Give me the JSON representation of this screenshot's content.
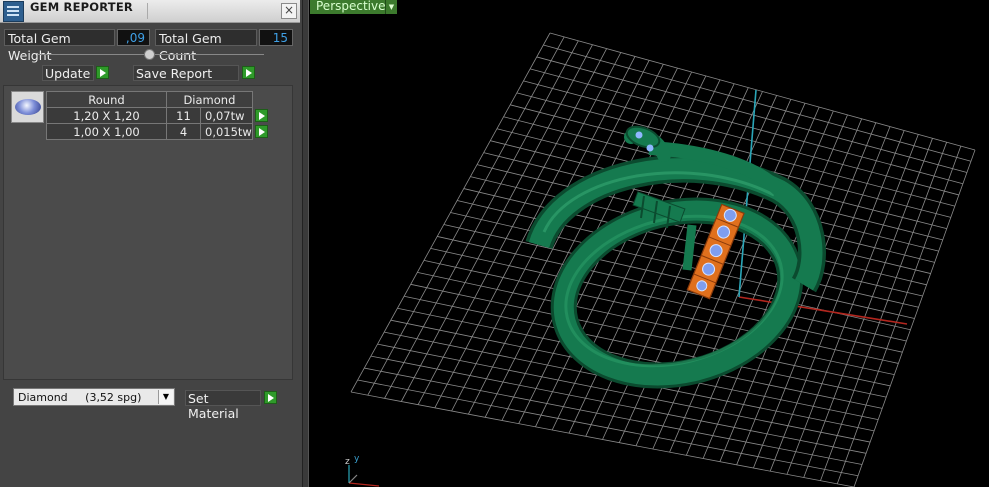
{
  "panel": {
    "title": "GEM REPORTER",
    "close_glyph": "×",
    "icons": {
      "app": "gem-reporter-icon",
      "close": "close-icon",
      "run": "play-arrow-icon",
      "dropdown": "chevron-down-icon"
    }
  },
  "totals": {
    "weight_label": "Total Gem Weight",
    "weight_value": ",09",
    "count_label": "Total Gem Count",
    "count_value": "15"
  },
  "actions": {
    "update_label": "Update",
    "save_label": "Save Report"
  },
  "report": {
    "headers": [
      "Round",
      "Diamond"
    ],
    "rows": [
      {
        "size": "1,20 X 1,20",
        "count": "11",
        "weight": "0,07tw"
      },
      {
        "size": "1,00 X 1,00",
        "count": "4",
        "weight": "0,015tw"
      }
    ]
  },
  "material": {
    "selected": "Diamond     (3,52 spg)",
    "set_label": "Set Material"
  },
  "viewport": {
    "label": "Perspective",
    "dropdown_glyph": "▼",
    "axis_labels": {
      "z": "z",
      "y": "y"
    }
  },
  "colors": {
    "panel_bg": "#444444",
    "value_text": "#3fa0e6",
    "go_button": "#2f9a2a",
    "view_label_bg": "#3c7a2d",
    "ring_green": "#157a4f",
    "gem_setting_orange": "#e0701d",
    "grid": "#8a8a8a",
    "axis_red": "#b3261e",
    "axis_cyan": "#2aa6b8"
  }
}
